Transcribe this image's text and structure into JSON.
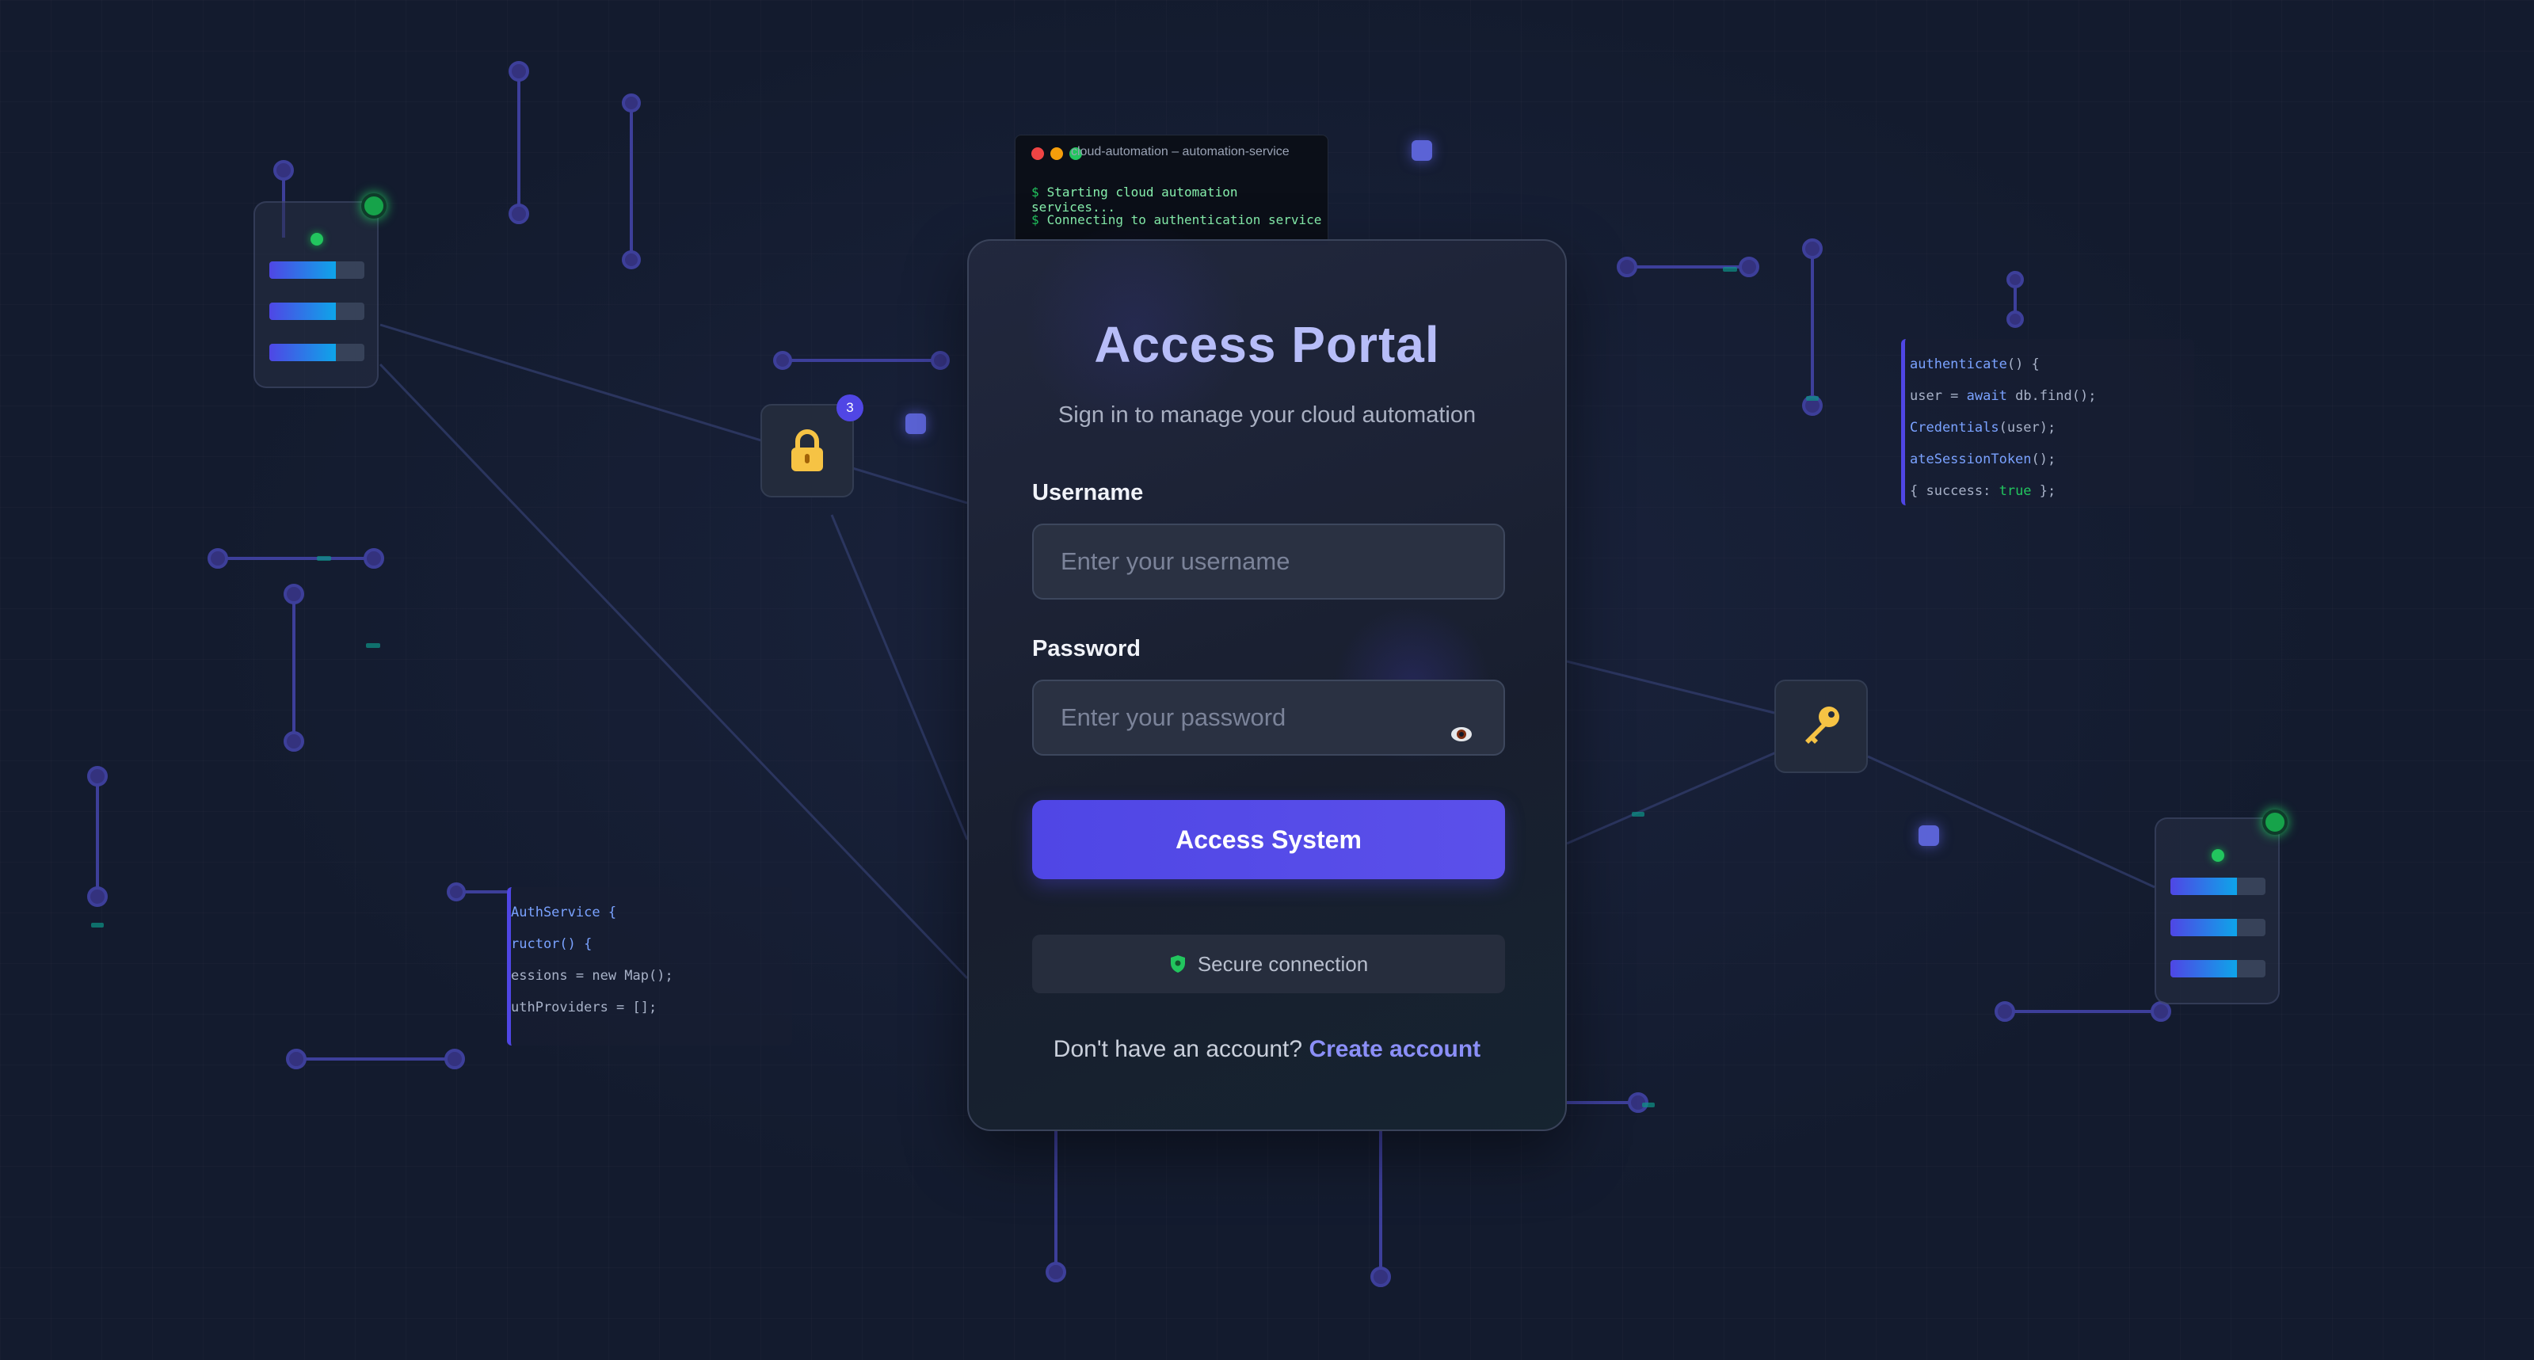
{
  "colors": {
    "background": "#131b2e",
    "accent": "#4f46e5",
    "title": "#b7bdf8",
    "link": "#8b8ff8",
    "success": "#22c55e",
    "lock_gold": "#f6c344"
  },
  "terminal": {
    "title": "cloud-automation – automation-service",
    "lines": [
      {
        "prompt": "$",
        "text": "Starting cloud automation services..."
      },
      {
        "prompt": "$",
        "text": "Connecting to authentication service"
      }
    ]
  },
  "code_snippet_right": {
    "lines": [
      {
        "a": "authenticate",
        "b": "() {"
      },
      {
        "a": "user = ",
        "kw": "await",
        "b": " db.find();"
      },
      {
        "a": "Credentials",
        "b": "(user);"
      },
      {
        "a": "ateSessionToken",
        "b": "();"
      },
      {
        "a": "{ success: ",
        "ok": "true",
        "b": " };"
      }
    ]
  },
  "code_snippet_left": {
    "lines": [
      "AuthService {",
      "ructor() {",
      "essions = new Map();",
      "uthProviders = [];"
    ]
  },
  "lock_widget": {
    "icon": "lock-icon",
    "badge_count": "3"
  },
  "key_widget": {
    "icon": "key-icon"
  },
  "server_cards": [
    {
      "bars": [
        0.7,
        0.7,
        0.7
      ]
    },
    {
      "bars": [
        0.7,
        0.7,
        0.7
      ]
    }
  ],
  "login": {
    "title": "Access Portal",
    "subtitle": "Sign in to manage your cloud automation",
    "username_label": "Username",
    "username_placeholder": "Enter your username",
    "username_value": "",
    "password_label": "Password",
    "password_placeholder": "Enter your password",
    "password_value": "",
    "password_toggle_icon": "eye-icon",
    "submit_label": "Access System",
    "secure_icon": "shield-icon",
    "secure_text": "Secure connection",
    "signup_prompt": "Don't have an account?",
    "signup_link": "Create account"
  }
}
